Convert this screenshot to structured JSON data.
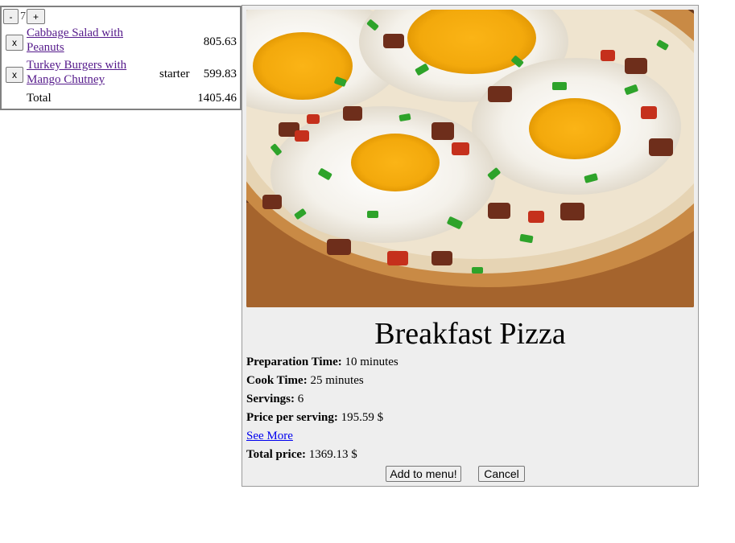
{
  "menu": {
    "minus_label": "-",
    "people_count": "7",
    "plus_label": "+",
    "items": [
      {
        "remove_label": "x",
        "name": "Cabbage Salad with Peanuts",
        "course": "",
        "price": "805.63"
      },
      {
        "remove_label": "x",
        "name": "Turkey Burgers with Mango Chutney",
        "course": "starter",
        "price": "599.83"
      }
    ],
    "total_label": "Total",
    "total_value": "1405.46"
  },
  "recipe": {
    "title": "Breakfast Pizza",
    "prep_label": "Preparation Time:",
    "prep_value": "10 minutes",
    "cook_label": "Cook Time:",
    "cook_value": "25 minutes",
    "servings_label": "Servings:",
    "servings_value": "6",
    "price_label": "Price per serving:",
    "price_value": "195.59 $",
    "see_more": "See More",
    "total_label": "Total price:",
    "total_value": "1369.13 $",
    "add_button": "Add to menu!",
    "cancel_button": "Cancel"
  }
}
